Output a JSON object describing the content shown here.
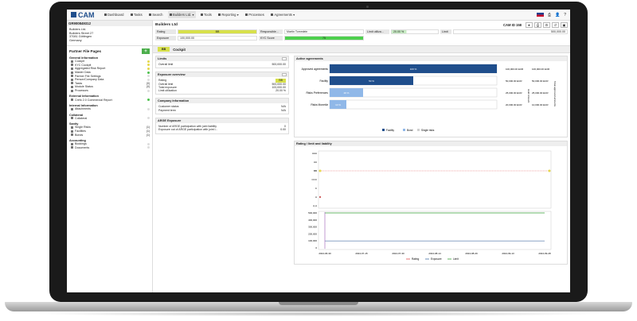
{
  "nav": {
    "logo": "CAM",
    "items": [
      {
        "label": "Dashboard",
        "icon": "home-icon",
        "active": false
      },
      {
        "label": "Tasks",
        "icon": "tasks-icon",
        "active": false
      },
      {
        "label": "Search",
        "icon": "search-icon",
        "active": false
      },
      {
        "label": "Builders Ltd. ▾",
        "icon": "folder-icon",
        "active": true
      },
      {
        "label": "Tools",
        "icon": "wrench-icon",
        "active": false
      },
      {
        "label": "Reporting ▾",
        "icon": "chart-icon",
        "active": false
      },
      {
        "label": "Processes",
        "icon": "process-icon",
        "active": false
      },
      {
        "label": "Agreements ▾",
        "icon": "document-icon",
        "active": false
      }
    ]
  },
  "header": {
    "partner_id": "GR900849312",
    "address": [
      "Builders Ltd.",
      "Builders Street 27",
      "37081 Göttingen",
      "Germany"
    ],
    "title": "Builders Ltd",
    "cam_id": "CAM ID 158",
    "rating_label": "Rating",
    "rating_value": "BB",
    "exposure_label": "Exposure",
    "exposure_value": "100,000.00",
    "responsible_label": "Responsible...",
    "responsible_value": "Martin Tommlein",
    "kyc_label": "KYC Score",
    "kyc_value": "75",
    "limit_util_label": "Limit utiliza...",
    "limit_util_value": "20.00 %",
    "limit_label": "Limit",
    "limit_value": "500,000.00"
  },
  "sidebar": {
    "title": "Partner File Pages",
    "groups": [
      {
        "name": "General Information",
        "items": [
          {
            "label": "Cockpit",
            "dot": "y"
          },
          {
            "label": "KYC Cockpit",
            "dot": "y"
          },
          {
            "label": "Aggregated Risk Report",
            "dot": "y"
          },
          {
            "label": "Master Data",
            "dot": "g"
          },
          {
            "label": "Partner File Settings",
            "dot": ""
          },
          {
            "label": "Person/Company Data",
            "dot": ""
          },
          {
            "label": "Tasks",
            "count": "(0)"
          },
          {
            "label": "Module Status",
            "count": "(0)"
          },
          {
            "label": "Processes",
            "dot": ""
          }
        ]
      },
      {
        "name": "External Information",
        "items": [
          {
            "label": "Crefo 2.0 Commercial Report",
            "dot": "g"
          }
        ]
      },
      {
        "name": "Internal Information",
        "items": [
          {
            "label": "Attachments",
            "dot": ""
          }
        ]
      },
      {
        "name": "Collateral",
        "items": [
          {
            "label": "Collateral",
            "dot": ""
          }
        ]
      },
      {
        "name": "Sanity",
        "items": [
          {
            "label": "Single Risks",
            "count": "(1)"
          },
          {
            "label": "Facilities",
            "count": "(1)"
          },
          {
            "label": "Bonds",
            "count": "(1)"
          }
        ]
      },
      {
        "name": "Accounting",
        "items": [
          {
            "label": "Bookings",
            "dot": ""
          },
          {
            "label": "Documents",
            "dot": ""
          }
        ]
      }
    ]
  },
  "tab": {
    "badge": "BB",
    "title": "Cockpit"
  },
  "limits": {
    "title": "Limits",
    "rows": [
      {
        "k": "Overall limit",
        "v": "500,000.00"
      }
    ]
  },
  "exposure": {
    "title": "Exposure overview",
    "rows": [
      {
        "k": "Rating",
        "v": "BB"
      },
      {
        "k": "Overall limit",
        "v": "500,000.00"
      },
      {
        "k": "Total exposure",
        "v": "100,000.00"
      },
      {
        "k": "Limit utilization",
        "v": "20.00 %"
      }
    ]
  },
  "company": {
    "title": "Company information",
    "rows": [
      {
        "k": "Customer status",
        "v": "N/A"
      },
      {
        "k": "Payment term",
        "v": "N/A"
      }
    ]
  },
  "arge": {
    "title": "ARGE Exposure",
    "rows": [
      {
        "k": "Number of ARGE participation with joint liability",
        "v": "0"
      },
      {
        "k": "Exposure out of ARGE participation with joint l...",
        "v": "0.00"
      }
    ]
  },
  "agreements": {
    "title": "Active agreements",
    "left_axis": "Hold Amount",
    "right_axis": "Total approved amounts",
    "legend_facility": "Facility",
    "legend_bond": "Bond",
    "legend_single": "Single risks"
  },
  "rating_chart": {
    "title": "Rating / limit and liability",
    "legend_rating": "Rating",
    "legend_exposure": "Exposure",
    "legend_limit": "Limit"
  },
  "chart_data": [
    {
      "type": "bar",
      "categories": [
        "Approved agreements",
        "Facility",
        "Risks Preferences",
        "Risks Monetär"
      ],
      "values": [
        100,
        50,
        20,
        10
      ],
      "value_labels": [
        "100 %",
        "50 %",
        "20 %",
        "10 %"
      ],
      "right_ticks": [
        "100,000.00 EUR",
        "50,000.00 EUR",
        "25,000.00 EUR",
        "20,000.00 EUR"
      ],
      "far_right_ticks": [
        "100,000.00 EUR",
        "50,000.00 EUR",
        "25,000.00 EUR",
        "10,000.00 EUR"
      ],
      "colors": [
        "#1f4e8c",
        "#1f4e8c",
        "#90b8e8",
        "#90b8e8"
      ]
    },
    {
      "type": "line",
      "title": "Rating",
      "y_categories": [
        "AAA",
        "AA",
        "BB",
        "CCC",
        "C",
        "A",
        "A,A"
      ],
      "x": [
        "2024-06-30",
        "2024-07-15",
        "2024-07-30",
        "2024-08-14",
        "2024-08-29",
        "2024-09-13",
        "2024-09-28"
      ],
      "rating_level": "BB"
    },
    {
      "type": "line",
      "ylim": [
        0,
        500000
      ],
      "y_ticks": [
        "500,000",
        "400,000",
        "300,000",
        "200,000",
        "100,000",
        "0"
      ],
      "x": [
        "2024-06-30",
        "2024-07-15",
        "2024-07-30",
        "2024-08-14",
        "2024-08-29",
        "2024-09-13",
        "2024-09-28"
      ],
      "series": [
        {
          "name": "Exposure",
          "values": [
            100000,
            100000,
            100000,
            100000,
            100000,
            100000,
            100000
          ]
        },
        {
          "name": "Limit",
          "values": [
            500000,
            500000,
            500000,
            500000,
            500000,
            500000,
            500000
          ]
        }
      ]
    }
  ],
  "colors": {
    "accent": "#1f4e8c",
    "light_bar": "#90b8e8",
    "yellow": "#d7e04a",
    "green": "#4dd04d",
    "add_green": "#4cae4c"
  }
}
